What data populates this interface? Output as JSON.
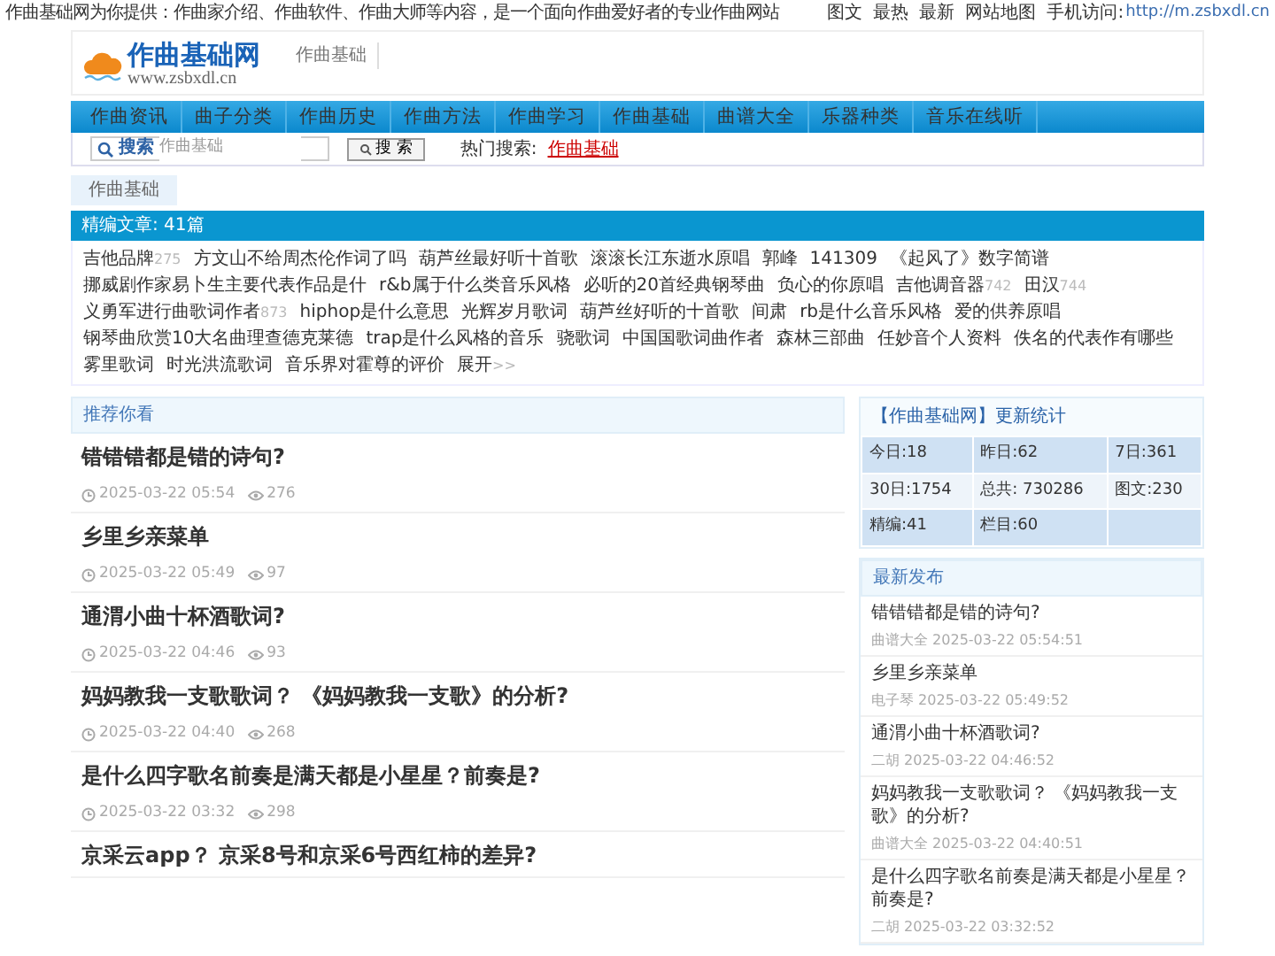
{
  "top_bar": {
    "intro": "作曲基础网为你提供：作曲家介绍、作曲软件、作曲大师等内容，是一个面向作曲爱好者的专业作曲网站",
    "links": [
      "图文",
      "最热",
      "最新",
      "网站地图"
    ],
    "mobile_label": "手机访问:",
    "mobile_url": "http://m.zsbxdl.cn"
  },
  "header": {
    "logo_name": "作曲基础网",
    "logo_domain": "www.zsbxdl.cn",
    "subnav": [
      "作曲基础"
    ]
  },
  "nav": [
    "作曲资讯",
    "曲子分类",
    "作曲历史",
    "作曲方法",
    "作曲学习",
    "作曲基础",
    "曲谱大全",
    "乐器种类",
    "音乐在线听"
  ],
  "search": {
    "label": "搜索",
    "value": "作曲基础",
    "button": "搜 索",
    "hot_label": "热门搜索:",
    "hot": [
      "作曲基础"
    ]
  },
  "breadcrumb": "作曲基础",
  "featured": {
    "title": "精编文章: 41篇",
    "tags": [
      {
        "text": "吉他品牌",
        "count": "275"
      },
      {
        "text": "方文山不给周杰伦作词了吗"
      },
      {
        "text": "葫芦丝最好听十首歌"
      },
      {
        "text": "滚滚长江东逝水原唱"
      },
      {
        "text": "郭峰"
      },
      {
        "text": "141309"
      },
      {
        "text": "《起风了》数字简谱"
      },
      {
        "text": "挪威剧作家易卜生主要代表作品是什"
      },
      {
        "text": "r&b属于什么类音乐风格"
      },
      {
        "text": "必听的20首经典钢琴曲"
      },
      {
        "text": "负心的你原唱"
      },
      {
        "text": "吉他调音器",
        "count": "742"
      },
      {
        "text": "田汉",
        "count": "744"
      },
      {
        "text": "义勇军进行曲歌词作者",
        "count": "873"
      },
      {
        "text": "hiphop是什么意思"
      },
      {
        "text": "光辉岁月歌词"
      },
      {
        "text": "葫芦丝好听的十首歌"
      },
      {
        "text": "间肃"
      },
      {
        "text": "rb是什么音乐风格"
      },
      {
        "text": "爱的供养原唱"
      },
      {
        "text": "钢琴曲欣赏10大名曲理查德克莱德"
      },
      {
        "text": "trap是什么风格的音乐"
      },
      {
        "text": "骁歌词"
      },
      {
        "text": "中国国歌词曲作者"
      },
      {
        "text": "森林三部曲"
      },
      {
        "text": "任妙音个人资料"
      },
      {
        "text": "佚名的代表作有哪些"
      },
      {
        "text": "雾里歌词"
      },
      {
        "text": "时光洪流歌词"
      },
      {
        "text": "音乐界对霍尊的评价"
      },
      {
        "text": "展开",
        "count": ">>"
      }
    ]
  },
  "recommend": {
    "title": "推荐你看",
    "articles": [
      {
        "title": "错错错都是错的诗句?",
        "time": "2025-03-22 05:54",
        "views": "276"
      },
      {
        "title": "乡里乡亲菜单",
        "time": "2025-03-22 05:49",
        "views": "97"
      },
      {
        "title": "通渭小曲十杯酒歌词?",
        "time": "2025-03-22 04:46",
        "views": "93"
      },
      {
        "title": "妈妈教我一支歌歌词？ 《妈妈教我一支歌》的分析?",
        "time": "2025-03-22 04:40",
        "views": "268"
      },
      {
        "title": "是什么四字歌名前奏是满天都是小星星？前奏是?",
        "time": "2025-03-22 03:32",
        "views": "298"
      },
      {
        "title": "京采云app？ 京采8号和京采6号西红柿的差异?"
      }
    ]
  },
  "stats": {
    "title": "【作曲基础网】更新统计",
    "rows": [
      [
        "今日:18",
        "昨日:62",
        "7日:361"
      ],
      [
        "30日:1754",
        "总共: 730286",
        "图文:230"
      ],
      [
        "精编:41",
        "栏目:60"
      ]
    ]
  },
  "latest": {
    "title": "最新发布",
    "items": [
      {
        "title": "错错错都是错的诗句?",
        "meta": "曲谱大全 2025-03-22 05:54:51"
      },
      {
        "title": "乡里乡亲菜单",
        "meta": "电子琴 2025-03-22 05:49:52"
      },
      {
        "title": "通渭小曲十杯酒歌词?",
        "meta": "二胡 2025-03-22 04:46:52"
      },
      {
        "title": "妈妈教我一支歌歌词？ 《妈妈教我一支歌》的分析?",
        "meta": "曲谱大全 2025-03-22 04:40:51"
      },
      {
        "title": "是什么四字歌名前奏是满天都是小星星？前奏是?",
        "meta": "二胡 2025-03-22 03:32:52"
      }
    ]
  }
}
